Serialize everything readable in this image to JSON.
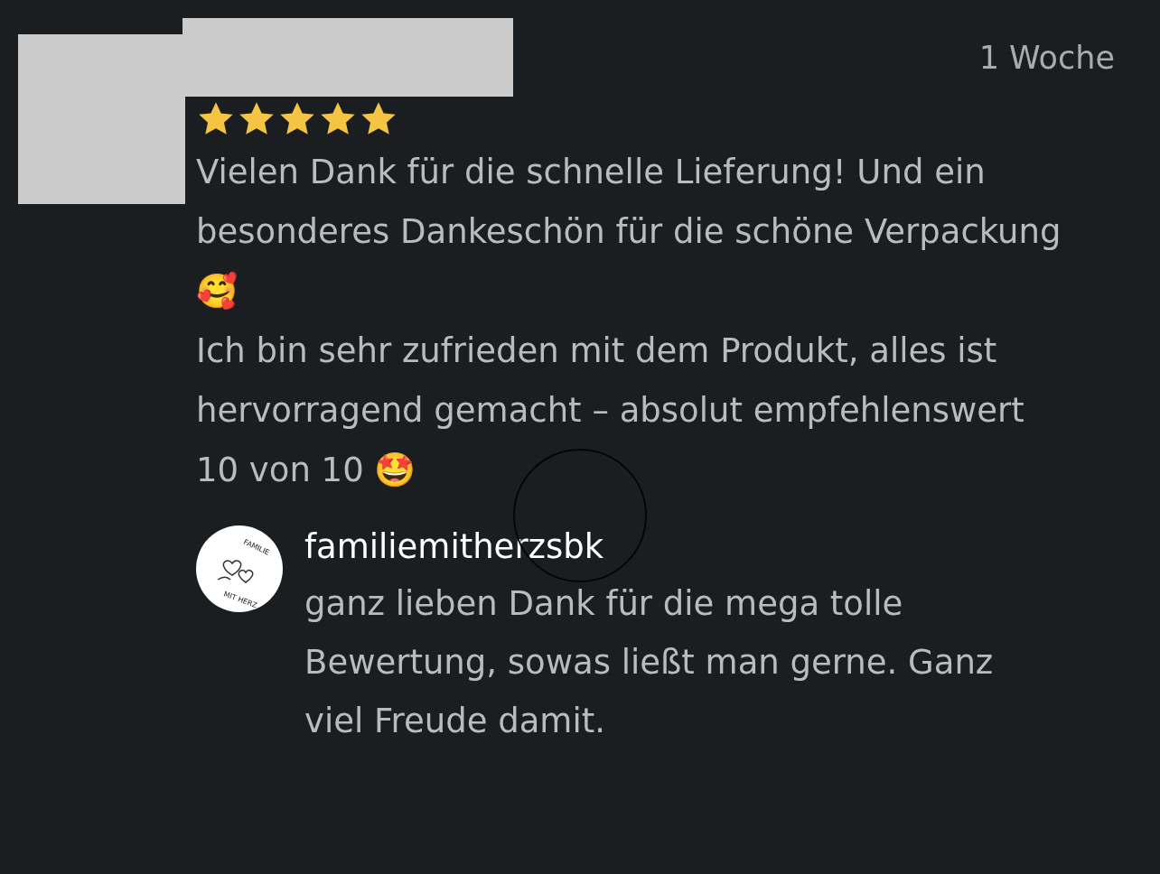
{
  "review": {
    "time": "1 Woche",
    "stars": 5,
    "paragraphs": [
      "Vielen Dank für die schnelle Lieferung! Und ein besonderes Dankeschön für die schöne Verpackung 🥰",
      "Ich bin sehr zufrieden mit dem Produkt, alles ist hervorragend gemacht – absolut empfehlenswert",
      "10 von 10 🤩"
    ]
  },
  "reply": {
    "logo_text": [
      "FAMILIE",
      "MIT HERZ"
    ],
    "username": "familiemitherzsbk",
    "text": "ganz lieben Dank für die mega tolle Bewertung, sowas ließt man gerne. Ganz viel Freude damit."
  }
}
